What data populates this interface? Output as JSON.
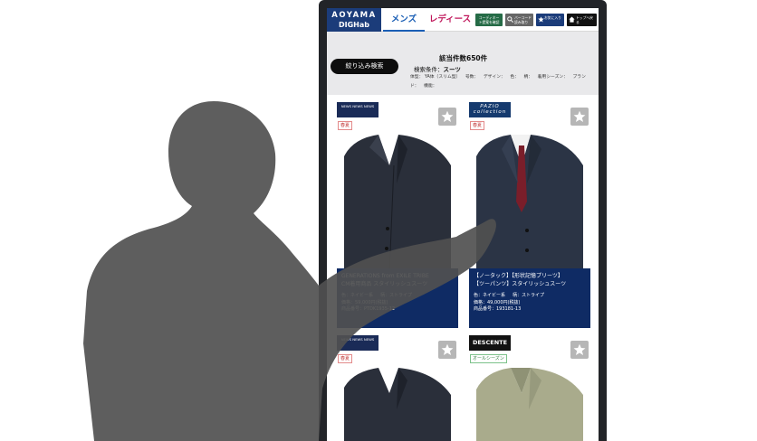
{
  "header": {
    "logo_line1": "AOYAMA",
    "logo_line2": "DIGHab",
    "tab_men": "メンズ",
    "tab_women": "レディース",
    "btn_coordinate": "コーディネート提案を確認",
    "btn_barcode": "バーコード読み取り",
    "btn_favorites": "お気に入り",
    "btn_top": "トップへ戻る"
  },
  "filter": {
    "button_label": "絞り込み検索",
    "result_count": "該当件数650件",
    "condition_label": "検索条件：",
    "condition_value": "スーツ",
    "details": [
      "体型： YA体（スリム型）",
      "号数：",
      "デザイン：",
      "色：",
      "柄：",
      "着用シーズン：",
      "ブランド：",
      "機能："
    ]
  },
  "products": [
    {
      "brand": "NEWS NEWS NEWS",
      "season": "春夏",
      "name_line1": "GENERATIONS from EXILE TRIBE",
      "name_line2": "CM着用商品 スタイリッシュスーツ",
      "color": "色：ネイビー系",
      "pattern": "柄：ストライプ",
      "price": "価格：59,000円(税抜)",
      "code": "商品番号：PTDK1935-12"
    },
    {
      "brand": "PAZIO collection",
      "season": "春夏",
      "name_line1": "【ノータック】【形状記憶プリーツ】",
      "name_line2": "【ツーパンツ】スタイリッシュスーツ",
      "color": "色：ネイビー系",
      "pattern": "柄：ストライプ",
      "price": "価格：49,000円(税抜)",
      "code": "商品番号：193181-13"
    },
    {
      "brand": "NEWS NEWS NEWS",
      "season": "春夏"
    },
    {
      "brand": "DESCENTE",
      "season": "オールシーズン"
    }
  ],
  "colors": {
    "logo_bg": "#1b3c7a",
    "men_tab": "#1b5fb5",
    "women_tab": "#c0175b",
    "info_panel": "#0f2b64",
    "filter_bg": "#e9e9eb"
  }
}
